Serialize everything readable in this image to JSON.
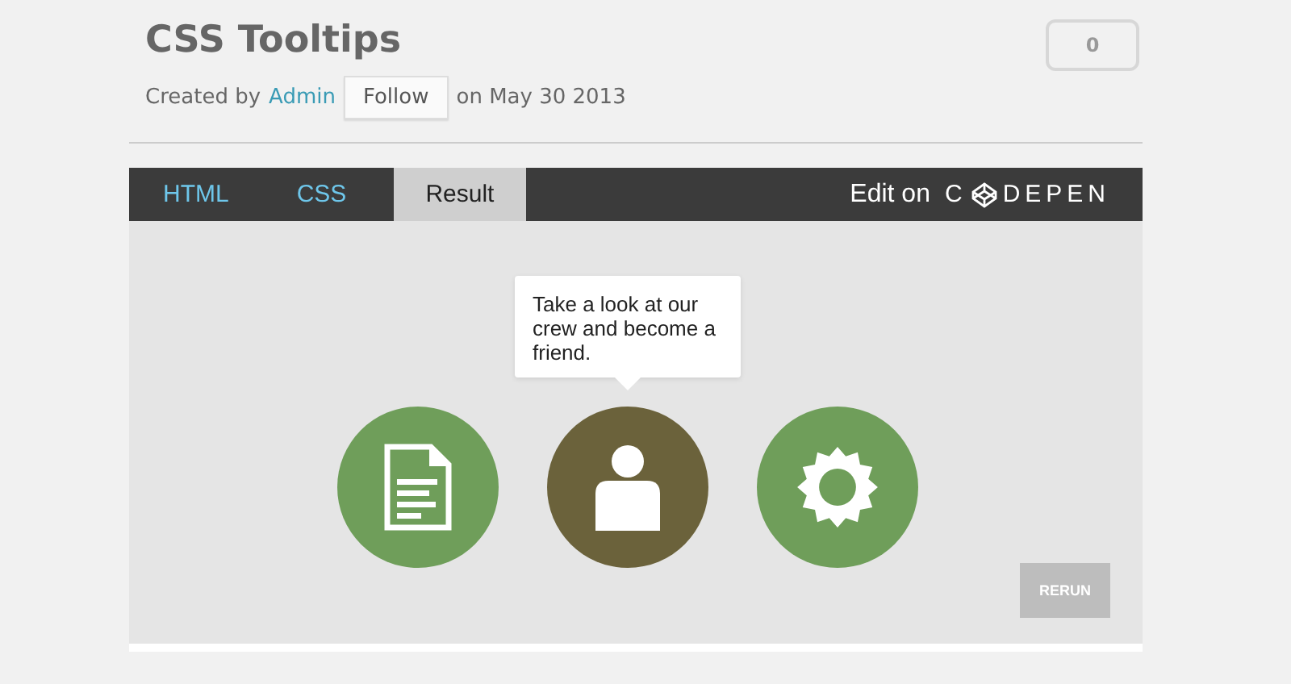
{
  "title": "CSS Tooltips",
  "meta": {
    "prefix": "Created by",
    "author": "Admin",
    "follow": "Follow",
    "date": "on May 30 2013"
  },
  "comment_count": "0",
  "tabs": [
    {
      "label": "HTML",
      "selected": false
    },
    {
      "label": "CSS",
      "selected": false
    },
    {
      "label": "Result",
      "selected": true
    }
  ],
  "edit_on": {
    "label": "Edit on",
    "brand_start": "C",
    "brand_end": "DEPEN"
  },
  "tooltip": "Take a look at our crew and become a friend.",
  "circles": [
    {
      "kind": "document",
      "selected": false
    },
    {
      "kind": "person",
      "selected": true
    },
    {
      "kind": "gear",
      "selected": false
    }
  ],
  "rerun": "RERUN"
}
